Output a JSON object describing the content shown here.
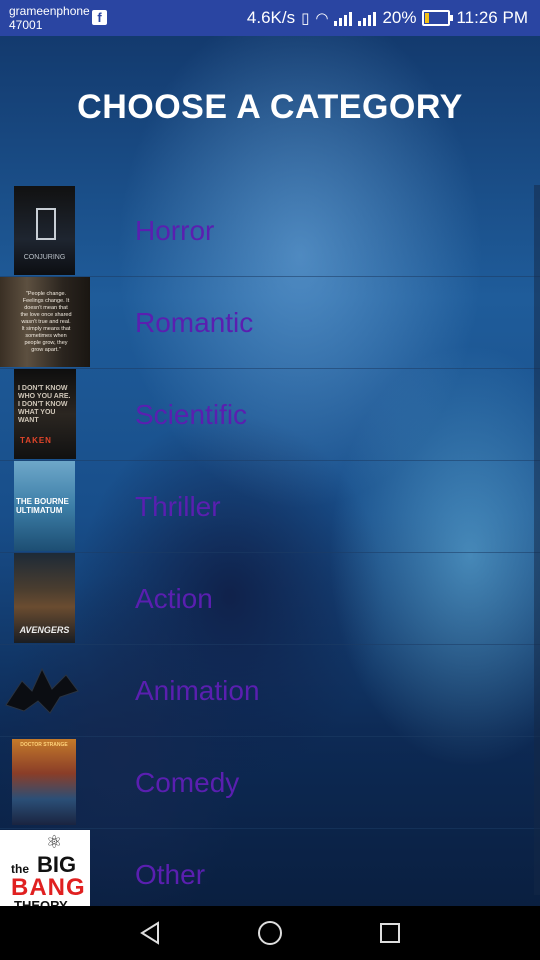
{
  "status_bar": {
    "carrier_name": "grameenphone",
    "carrier_code": "47001",
    "notification_icon": "facebook-icon",
    "speed": "4.6K/s",
    "battery_percent": "20%",
    "battery_level": 0.2,
    "time": "11:26 PM"
  },
  "title": "CHOOSE A CATEGORY",
  "categories": [
    {
      "label": "Horror",
      "poster_text": "CONJURING"
    },
    {
      "label": "Romantic",
      "poster_text": "\"People change. Feelings change. It doesn't mean that the love once shared wasn't true and real. It simply means that sometimes when people grow, they grow apart.\""
    },
    {
      "label": "Scientific",
      "poster_text": "I DON'T KNOW WHO YOU ARE. I DON'T KNOW WHAT YOU WANT",
      "poster_title": "TAKEN"
    },
    {
      "label": "Thriller",
      "poster_text": "THE BOURNE ULTIMATUM"
    },
    {
      "label": "Action",
      "poster_text": "AVENGERS"
    },
    {
      "label": "Animation",
      "poster_text": ""
    },
    {
      "label": "Comedy",
      "poster_text": "DOCTOR STRANGE"
    },
    {
      "label": "Other",
      "poster_the": "the",
      "poster_big": "BIG",
      "poster_bang": "BANG",
      "poster_theory": "THEORY"
    }
  ],
  "colors": {
    "status_bar": "#2a45a2",
    "label": "#5a1fb0",
    "title": "#ffffff",
    "battery": "#f3c116"
  }
}
